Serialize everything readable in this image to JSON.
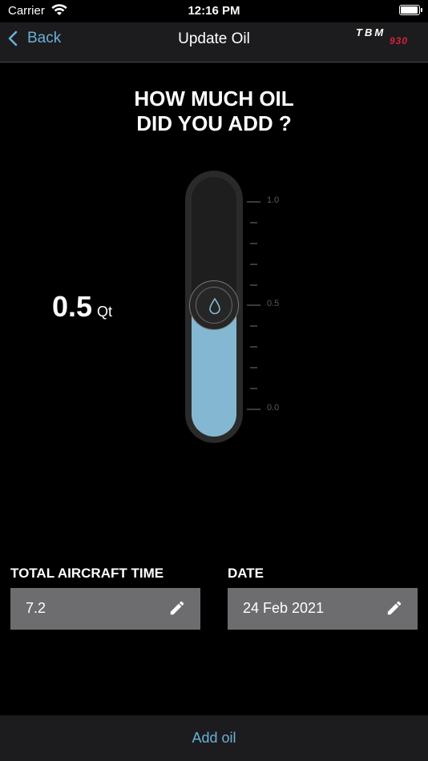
{
  "status_bar": {
    "carrier": "Carrier",
    "time": "12:16 PM"
  },
  "nav": {
    "back_label": "Back",
    "title": "Update Oil",
    "logo_text": "TBM",
    "logo_model": "930"
  },
  "question": {
    "line1": "HOW MUCH OIL",
    "line2": "DID YOU ADD ?"
  },
  "oil": {
    "amount": "0.5",
    "unit": "Qt",
    "fill_fraction": 0.5
  },
  "gauge": {
    "scale_labels": [
      "1.0",
      "0.5",
      "0.0"
    ]
  },
  "fields": {
    "aircraft_time": {
      "label": "TOTAL AIRCRAFT TIME",
      "value": "7.2"
    },
    "date": {
      "label": "DATE",
      "value": "24 Feb 2021"
    }
  },
  "footer": {
    "action_label": "Add oil"
  },
  "colors": {
    "accent": "#6ab0d8",
    "fill": "#84b8d2",
    "logo_red": "#d5213a"
  }
}
